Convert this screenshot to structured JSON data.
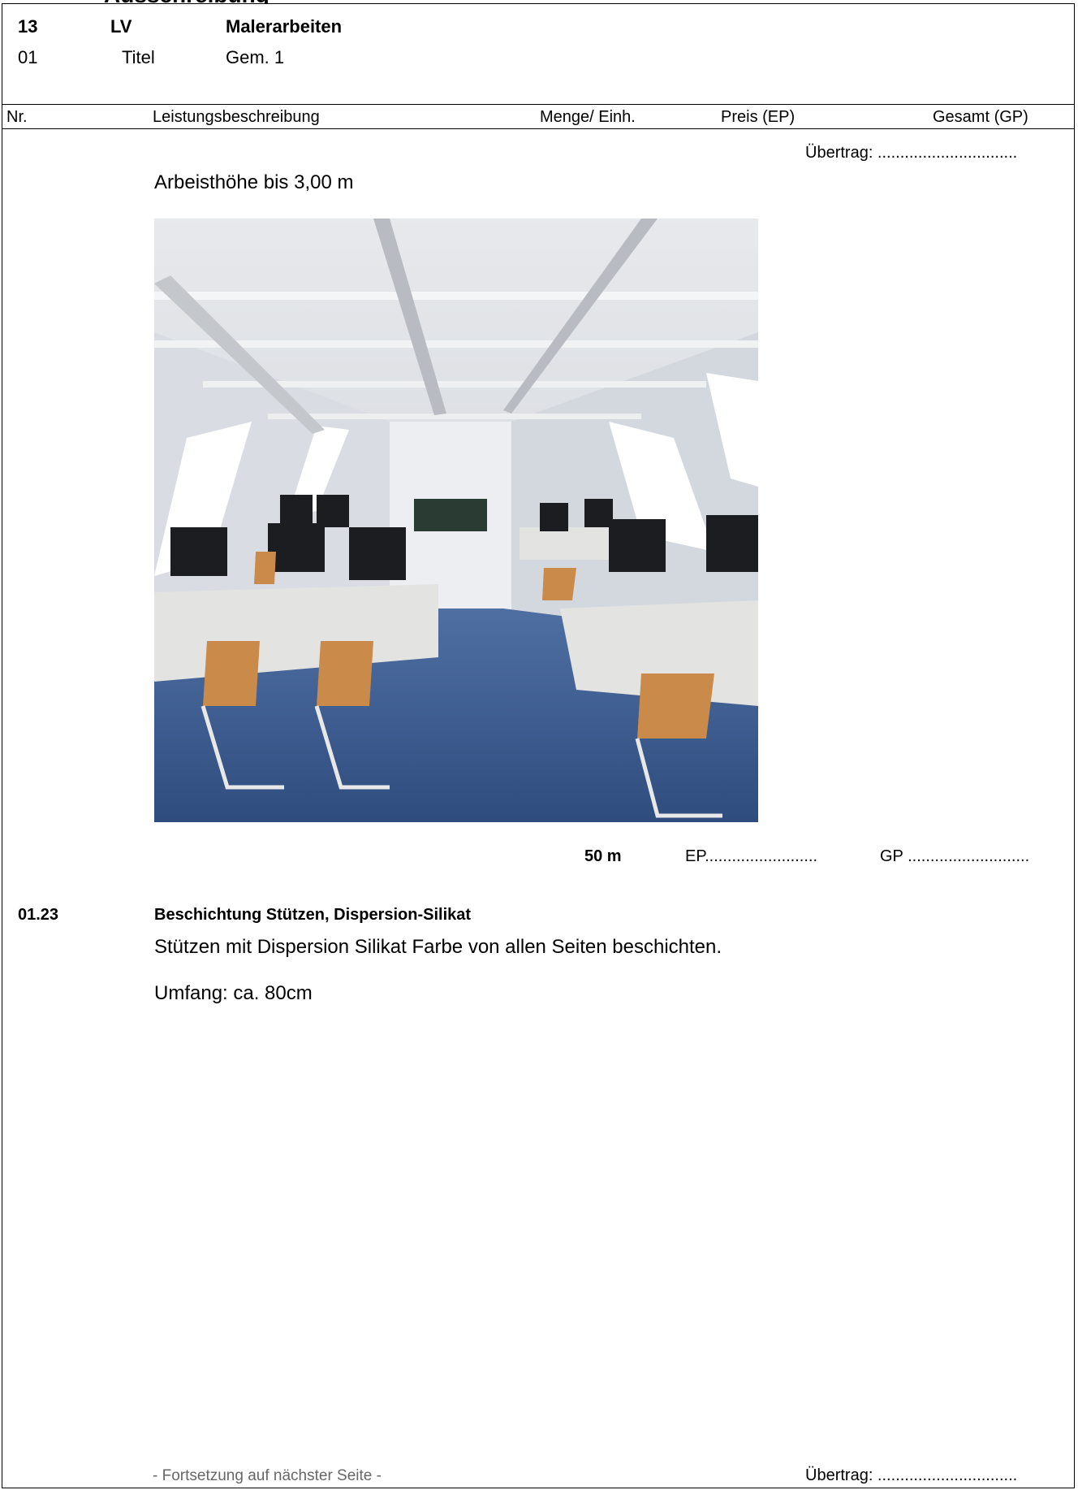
{
  "header": {
    "row1": {
      "number": "13",
      "type": "LV",
      "title": "Malerarbeiten"
    },
    "row2": {
      "number": "01",
      "type": "Titel",
      "title": "Gem. 1"
    }
  },
  "columns": {
    "nr": "Nr.",
    "description": "Leistungsbeschreibung",
    "quantity": "Menge/ Einh.",
    "unit_price": "Preis (EP)",
    "total": "Gesamt (GP)"
  },
  "carry_over_top": "Übertrag: ...............................",
  "position_prev": {
    "note": "Arbeisthöhe bis 3,00 m",
    "quantity": "50 m",
    "ep": "EP.........................",
    "gp": "GP ..........................."
  },
  "position_next": {
    "number": "01.23",
    "title": "Beschichtung Stützen, Dispersion-Silikat",
    "description": "Stützen mit Dispersion Silikat Farbe von allen Seiten beschichten.",
    "scope": "Umfang: ca. 80cm"
  },
  "footer": {
    "continuation": "- Fortsetzung auf nächster Seite -",
    "carry_over_bottom": "Übertrag: ..............................."
  }
}
